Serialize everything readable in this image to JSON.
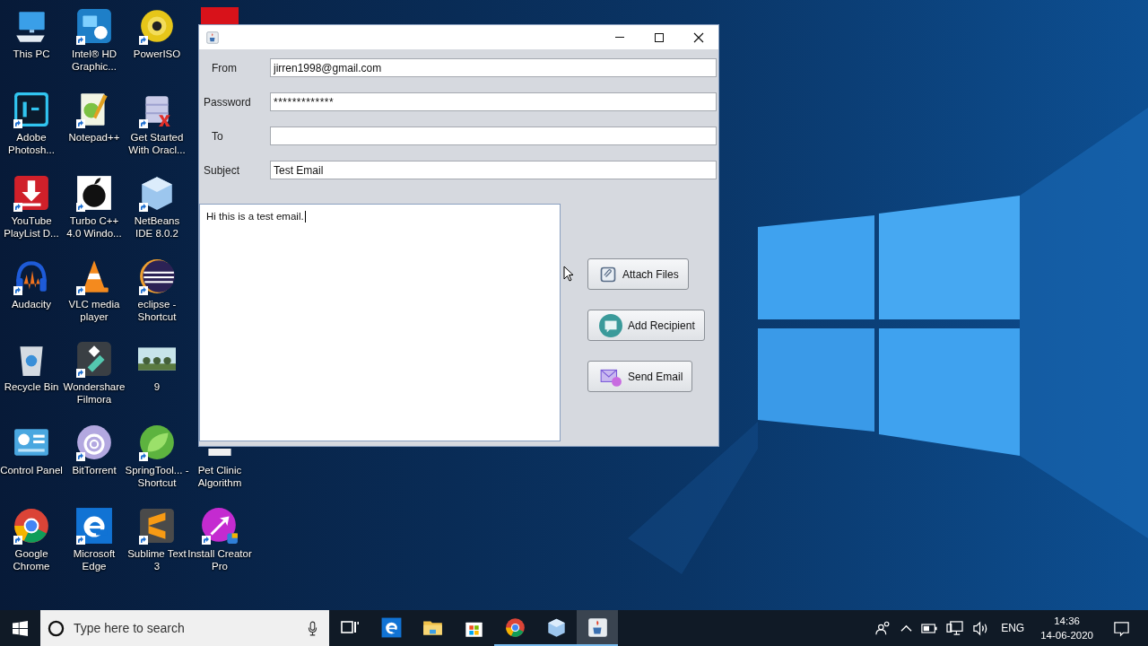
{
  "desktop_icons": [
    [
      {
        "kind": "thispc",
        "label": "This PC",
        "shortcut": false
      },
      {
        "kind": "photoshop",
        "label": "Adobe Photosh...",
        "shortcut": true
      },
      {
        "kind": "youtube",
        "label": "YouTube PlayList D...",
        "shortcut": true
      },
      {
        "kind": "audacity",
        "label": "Audacity",
        "shortcut": true
      },
      {
        "kind": "recycle",
        "label": "Recycle Bin",
        "shortcut": false
      },
      {
        "kind": "controlpanel",
        "label": "Control Panel",
        "shortcut": false
      },
      {
        "kind": "chrome",
        "label": "Google Chrome",
        "shortcut": true
      }
    ],
    [
      {
        "kind": "intel",
        "label": "Intel® HD Graphic...",
        "shortcut": true
      },
      {
        "kind": "notepad",
        "label": "Notepad++",
        "shortcut": true
      },
      {
        "kind": "turbo",
        "label": "Turbo C++ 4.0 Windo...",
        "shortcut": true
      },
      {
        "kind": "vlc",
        "label": "VLC media player",
        "shortcut": true
      },
      {
        "kind": "filmora",
        "label": "Wondershare Filmora",
        "shortcut": true
      },
      {
        "kind": "bittorrent",
        "label": "BitTorrent",
        "shortcut": true
      },
      {
        "kind": "edge",
        "label": "Microsoft Edge",
        "shortcut": true
      }
    ],
    [
      {
        "kind": "poweriso",
        "label": "PowerISO",
        "shortcut": true
      },
      {
        "kind": "oracle",
        "label": "Get Started With Oracl...",
        "shortcut": true
      },
      {
        "kind": "netbeans",
        "label": "NetBeans IDE 8.0.2",
        "shortcut": true
      },
      {
        "kind": "eclipse",
        "label": "eclipse - Shortcut",
        "shortcut": true
      },
      {
        "label": "9",
        "shortcut": false
      },
      {
        "kind": "spring",
        "label": "SpringTool... - Shortcut",
        "shortcut": true
      },
      {
        "kind": "sublime",
        "label": "Sublime Text 3",
        "shortcut": true
      }
    ],
    [
      {
        "kind": "acrobat",
        "shortcut": false
      },
      {
        "kind": "petclinic",
        "label": "Pet Clinic Algorithm",
        "shortcut": false
      },
      {
        "kind": "installcreator",
        "label": "Install Creator Pro",
        "shortcut": true
      }
    ]
  ],
  "window": {
    "fields": [
      {
        "label": "From",
        "value": "jirren1998@gmail.com",
        "kind": "text"
      },
      {
        "label": "Password",
        "value": "*************",
        "kind": "password"
      },
      {
        "label": "To",
        "kind": "text"
      },
      {
        "label": "Subject",
        "value": "Test Email",
        "kind": "text"
      }
    ],
    "message": "Hi this is a test email.",
    "buttons": [
      {
        "label": "Attach Files"
      },
      {
        "label": "Add Recipient"
      },
      {
        "label": "Send Email"
      }
    ]
  },
  "taskbar": {
    "search": {
      "placeholder": "Type here to search"
    },
    "apps": [
      {
        "kind": "taskview",
        "running": false,
        "selected": false
      },
      {
        "kind": "edge",
        "running": false,
        "selected": false
      },
      {
        "kind": "folder",
        "running": false,
        "selected": false
      },
      {
        "kind": "store",
        "running": false,
        "selected": false
      },
      {
        "kind": "chrome",
        "running": true,
        "selected": false
      },
      {
        "kind": "cube",
        "running": true,
        "selected": false
      },
      {
        "kind": "java",
        "running": true,
        "selected": true
      }
    ],
    "language": "ENG",
    "time": "14:36",
    "date": "14-06-2020"
  }
}
